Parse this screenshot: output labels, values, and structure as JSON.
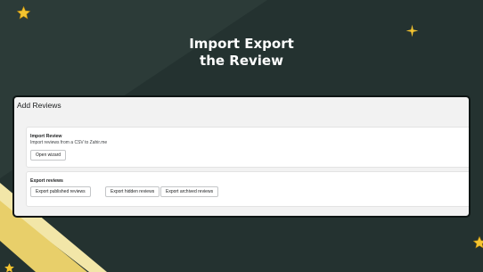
{
  "headline": {
    "line1": "Import Export",
    "line2": "the Review"
  },
  "app": {
    "title": "Add Reviews",
    "import_card": {
      "title": "Import Review",
      "description": "Import reviews from a CSV to Zahir.me",
      "button": "Open wizard"
    },
    "export_card": {
      "title": "Export reviews",
      "buttons": [
        "Export published reviews",
        "Export hidden reviews",
        "Export archived reviews"
      ]
    }
  },
  "colors": {
    "background": "#243230",
    "accent_gold": "#f4c430",
    "diagonal_light": "#fff6c8"
  },
  "icons": [
    "star-icon"
  ]
}
